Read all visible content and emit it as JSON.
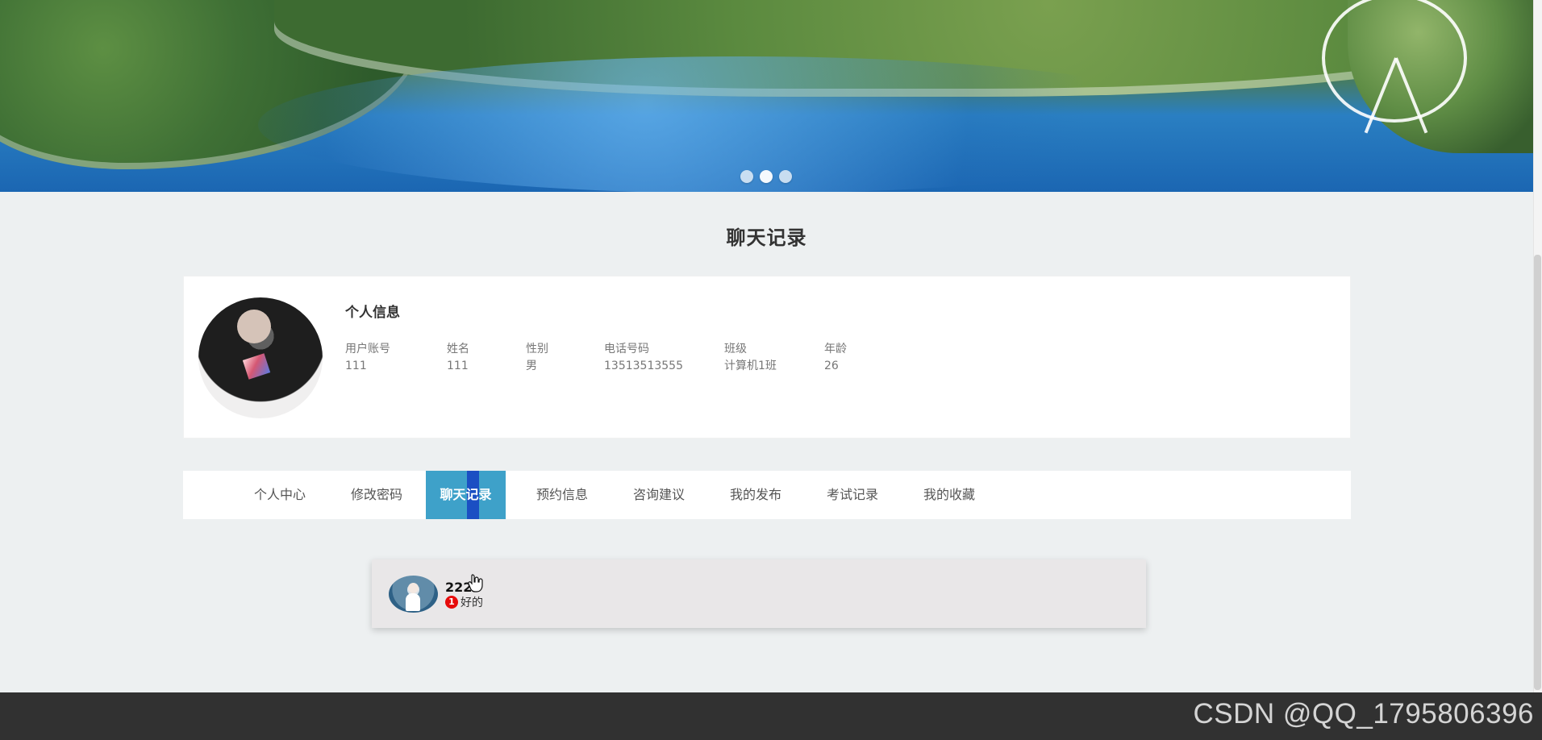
{
  "banner": {
    "active_dot_index": 1
  },
  "page_title": "聊天记录",
  "profile": {
    "heading": "个人信息",
    "fields": [
      {
        "label": "用户账号",
        "value": "111"
      },
      {
        "label": "姓名",
        "value": "111"
      },
      {
        "label": "性别",
        "value": "男"
      },
      {
        "label": "电话号码",
        "value": "13513513555"
      },
      {
        "label": "班级",
        "value": "计算机1班"
      },
      {
        "label": "年龄",
        "value": "26"
      }
    ]
  },
  "tabs": [
    {
      "label": "个人中心",
      "active": false
    },
    {
      "label": "修改密码",
      "active": false
    },
    {
      "label": "聊天记录",
      "active": true
    },
    {
      "label": "预约信息",
      "active": false
    },
    {
      "label": "咨询建议",
      "active": false
    },
    {
      "label": "我的发布",
      "active": false
    },
    {
      "label": "考试记录",
      "active": false
    },
    {
      "label": "我的收藏",
      "active": false
    }
  ],
  "chat": {
    "name": "222",
    "unread_count": "1",
    "preview": "好的"
  },
  "footer": {
    "watermark": "CSDN @QQ_1795806396"
  },
  "colors": {
    "accent_tab": "#3ea1c9",
    "active_strip": "#1b4fc3",
    "unread_badge": "#e60b0b",
    "footer": "#313131"
  }
}
